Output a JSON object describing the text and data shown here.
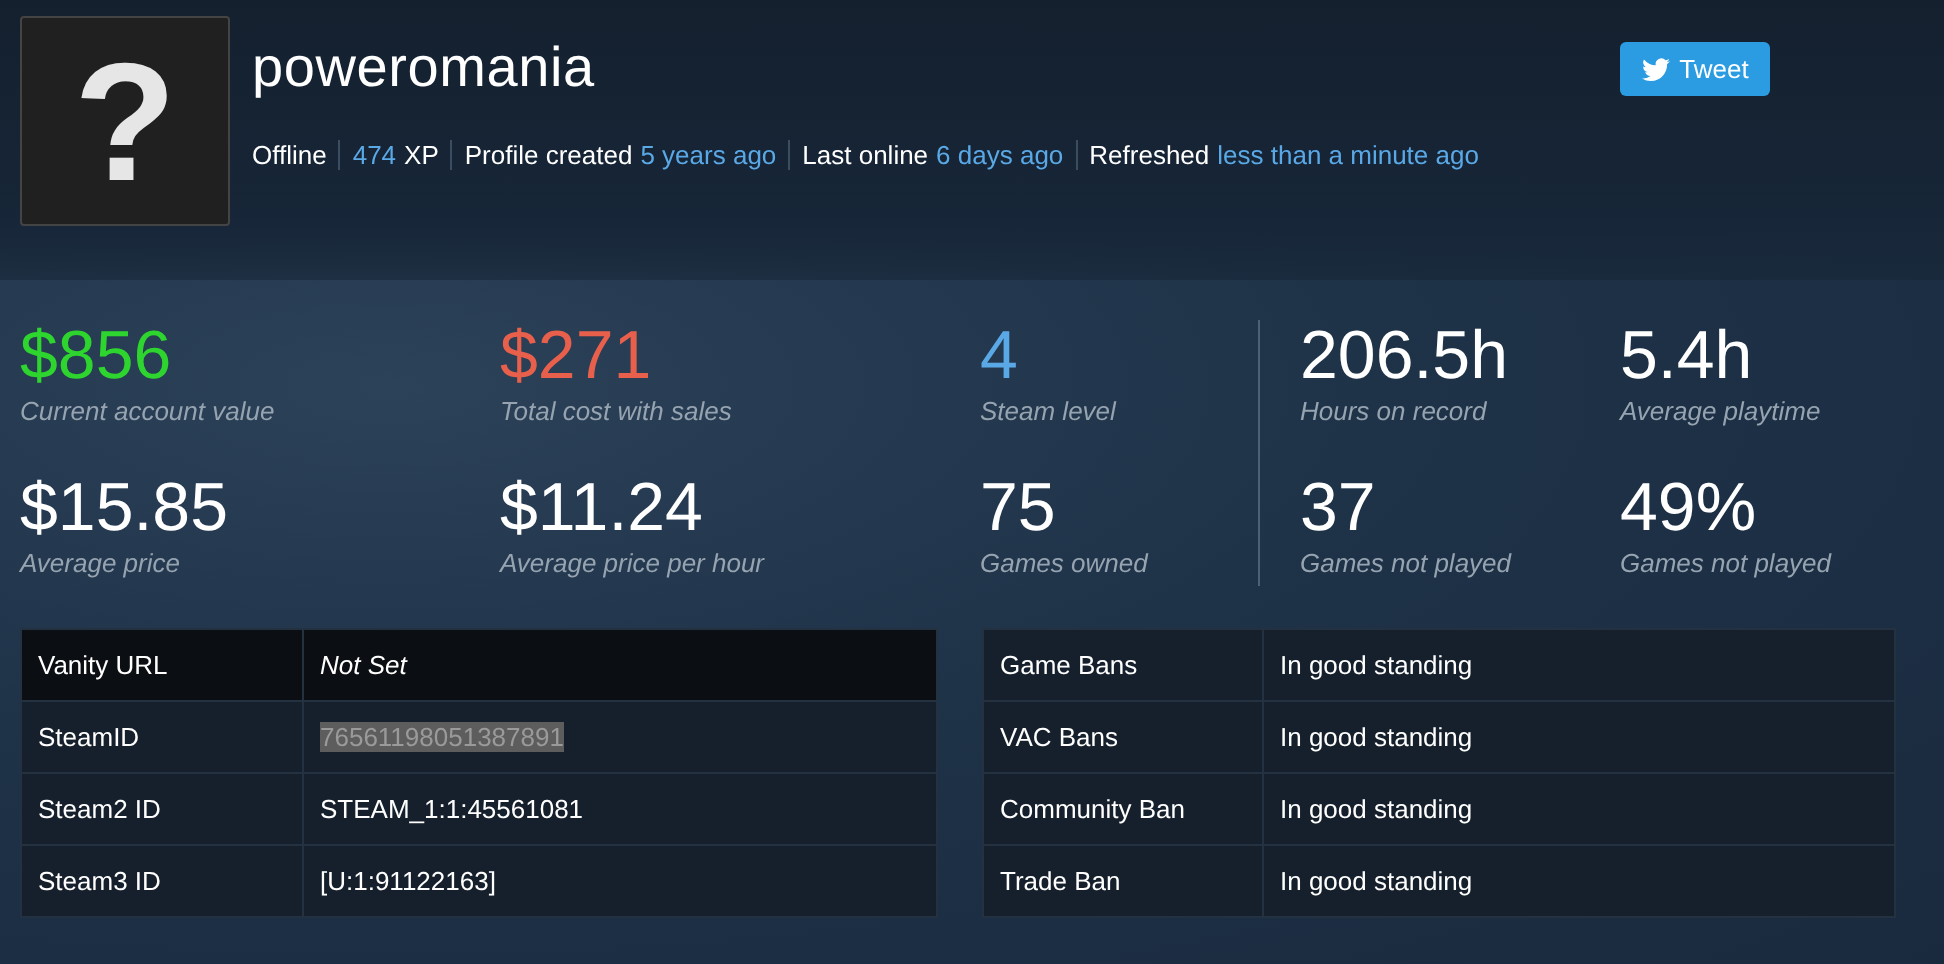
{
  "profile": {
    "name": "poweromania",
    "avatar_glyph": "?",
    "status": "Offline",
    "xp_value": "474",
    "xp_unit": "XP",
    "meta": [
      {
        "label": "Profile created",
        "value": "5 years ago"
      },
      {
        "label": "Last online",
        "value": "6 days ago"
      },
      {
        "label": "Refreshed",
        "value": "less than a minute ago"
      }
    ]
  },
  "tweet_button": {
    "label": "Tweet"
  },
  "stats": [
    {
      "value": "$856",
      "label": "Current account value",
      "color": "#2ed52e"
    },
    {
      "value": "$271",
      "label": "Total cost with sales",
      "color": "#e8604c"
    },
    {
      "value": "4",
      "label": "Steam level",
      "color": "#5aa9e6"
    },
    {
      "value": "206.5h",
      "label": "Hours on record",
      "color": "#ffffff"
    },
    {
      "value": "5.4h",
      "label": "Average playtime",
      "color": "#ffffff"
    },
    {
      "value": "$15.85",
      "label": "Average price",
      "color": "#ffffff"
    },
    {
      "value": "$11.24",
      "label": "Average price per hour",
      "color": "#ffffff"
    },
    {
      "value": "75",
      "label": "Games owned",
      "color": "#ffffff"
    },
    {
      "value": "37",
      "label": "Games not played",
      "color": "#ffffff"
    },
    {
      "value": "49%",
      "label": "Games not played",
      "color": "#ffffff"
    }
  ],
  "ids_table": [
    {
      "label": "Vanity URL",
      "value": "Not Set",
      "kind": "unset"
    },
    {
      "label": "SteamID",
      "value": "76561198051387891",
      "kind": "highlighted"
    },
    {
      "label": "Steam2 ID",
      "value": "STEAM_1:1:45561081",
      "kind": "plain"
    },
    {
      "label": "Steam3 ID",
      "value": "[U:1:91122163]",
      "kind": "plain"
    }
  ],
  "bans_table": [
    {
      "label": "Game Bans",
      "value": "In good standing"
    },
    {
      "label": "VAC Bans",
      "value": "In good standing"
    },
    {
      "label": "Community Ban",
      "value": "In good standing"
    },
    {
      "label": "Trade Ban",
      "value": "In good standing"
    }
  ]
}
